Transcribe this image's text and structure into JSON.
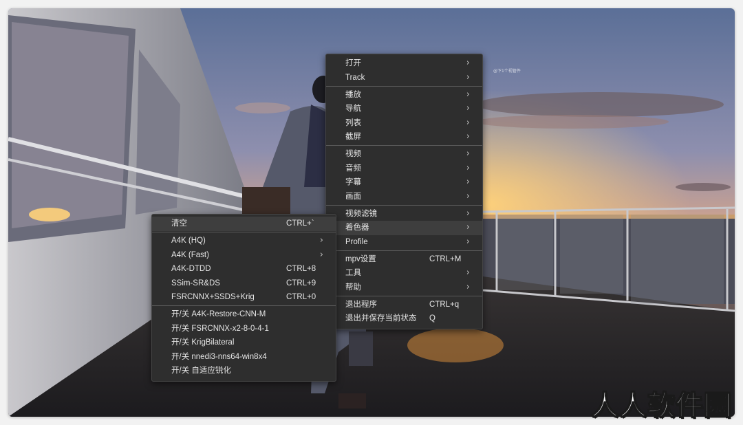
{
  "main_menu": {
    "items": [
      {
        "label": "打开",
        "shortcut": "",
        "arrow": "›"
      },
      {
        "label": "Track",
        "shortcut": "",
        "arrow": "›"
      },
      {
        "sep": true
      },
      {
        "label": "播放",
        "shortcut": "",
        "arrow": "›"
      },
      {
        "label": "导航",
        "shortcut": "",
        "arrow": "›"
      },
      {
        "label": "列表",
        "shortcut": "",
        "arrow": "›"
      },
      {
        "label": "截屏",
        "shortcut": "",
        "arrow": "›"
      },
      {
        "sep": true
      },
      {
        "label": "视频",
        "shortcut": "",
        "arrow": "›"
      },
      {
        "label": "音频",
        "shortcut": "",
        "arrow": "›"
      },
      {
        "label": "字幕",
        "shortcut": "",
        "arrow": "›"
      },
      {
        "label": "画面",
        "shortcut": "",
        "arrow": "›"
      },
      {
        "sep": true
      },
      {
        "label": "视频滤镜",
        "shortcut": "",
        "arrow": "›"
      },
      {
        "label": "着色器",
        "shortcut": "",
        "arrow": "›",
        "highlight": true
      },
      {
        "label": "Profile",
        "shortcut": "",
        "arrow": "›"
      },
      {
        "sep": true
      },
      {
        "label": "mpv设置",
        "shortcut": "CTRL+M",
        "arrow": ""
      },
      {
        "label": "工具",
        "shortcut": "",
        "arrow": "›"
      },
      {
        "label": "帮助",
        "shortcut": "",
        "arrow": "›"
      },
      {
        "sep": true
      },
      {
        "label": "退出程序",
        "shortcut": "CTRL+q",
        "arrow": ""
      },
      {
        "label": "退出并保存当前状态",
        "shortcut": "Q",
        "arrow": ""
      }
    ]
  },
  "shader_submenu": {
    "items": [
      {
        "label": "清空",
        "shortcut": "CTRL+`",
        "arrow": "",
        "highlight": true
      },
      {
        "sep": true
      },
      {
        "label": "A4K (HQ)",
        "shortcut": "",
        "arrow": "›"
      },
      {
        "label": "A4K (Fast)",
        "shortcut": "",
        "arrow": "›"
      },
      {
        "label": "A4K-DTDD",
        "shortcut": "CTRL+8",
        "arrow": ""
      },
      {
        "label": "SSim-SR&DS",
        "shortcut": "CTRL+9",
        "arrow": ""
      },
      {
        "label": "FSRCNNX+SSDS+Krig",
        "shortcut": "CTRL+0",
        "arrow": ""
      },
      {
        "sep": true
      },
      {
        "label": "开/关 A4K-Restore-CNN-M",
        "shortcut": "",
        "arrow": ""
      },
      {
        "label": "开/关 FSRCNNX-x2-8-0-4-1",
        "shortcut": "",
        "arrow": ""
      },
      {
        "label": "开/关 KrigBilateral",
        "shortcut": "",
        "arrow": ""
      },
      {
        "label": "开/关 nnedi3-nns64-win8x4",
        "shortcut": "",
        "arrow": ""
      },
      {
        "label": "开/关 自适应锐化",
        "shortcut": "",
        "arrow": ""
      }
    ]
  },
  "watermark": {
    "text": "人人软件园"
  },
  "colors": {
    "menu_bg": "#2e2e2e",
    "menu_text": "#e6e6e6",
    "menu_highlight": "#3e3e3e",
    "separator": "#5a5a5a"
  }
}
